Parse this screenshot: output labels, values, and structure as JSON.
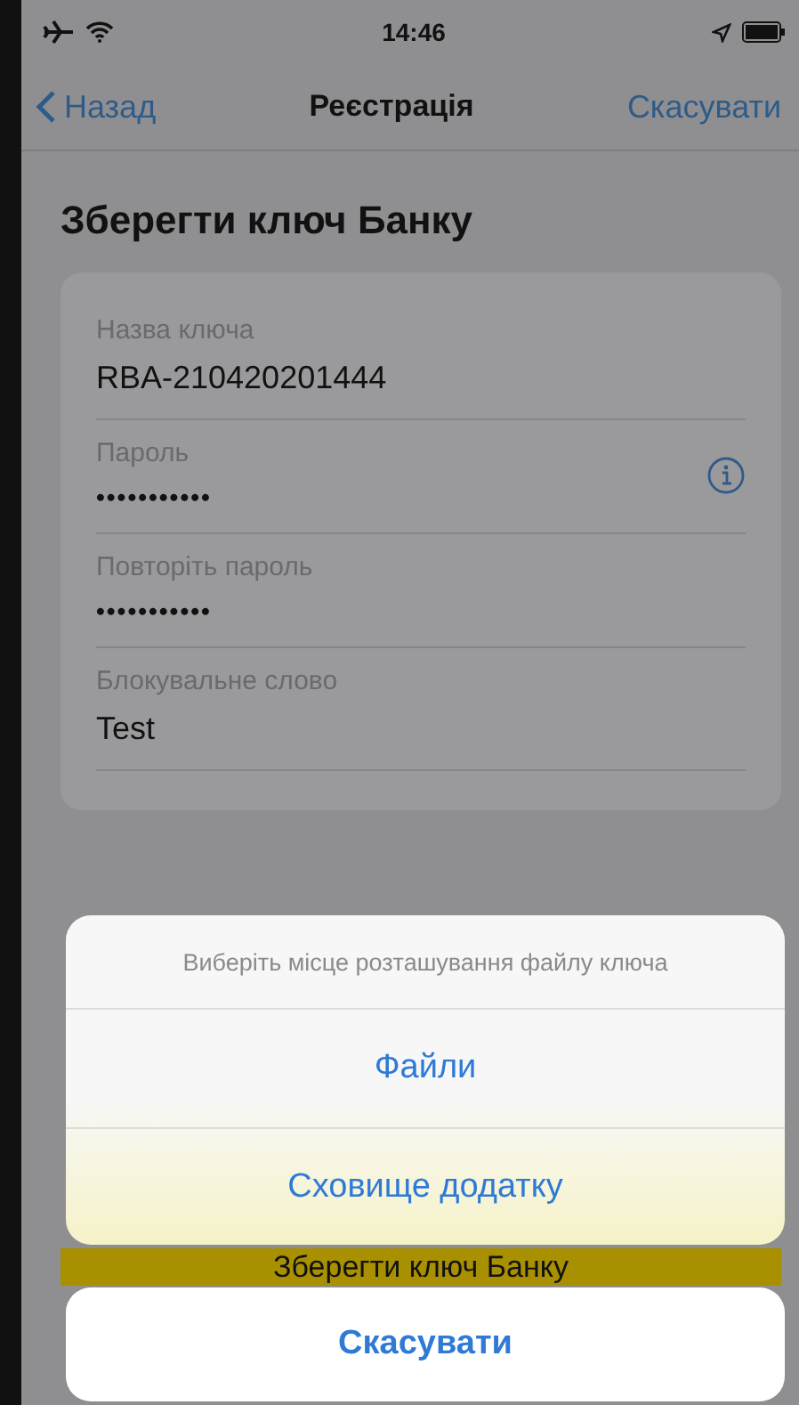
{
  "status_bar": {
    "time": "14:46"
  },
  "nav": {
    "back": "Назад",
    "title": "Реєстрація",
    "action": "Скасувати"
  },
  "heading": "Зберегти ключ Банку",
  "fields": [
    {
      "label": "Назва ключа",
      "value": "RBA-210420201444",
      "kind": "text",
      "info": false
    },
    {
      "label": "Пароль",
      "value": "•••••••••••",
      "kind": "password",
      "info": true
    },
    {
      "label": "Повторіть пароль",
      "value": "•••••••••••",
      "kind": "password",
      "info": false
    },
    {
      "label": "Блокувальне слово",
      "value": "Test",
      "kind": "text",
      "info": false
    }
  ],
  "save_button": "Зберегти ключ Банку",
  "action_sheet": {
    "title": "Виберіть місце розташування файлу ключа",
    "options": [
      "Файли",
      "Сховище додатку"
    ],
    "cancel": "Скасувати"
  }
}
